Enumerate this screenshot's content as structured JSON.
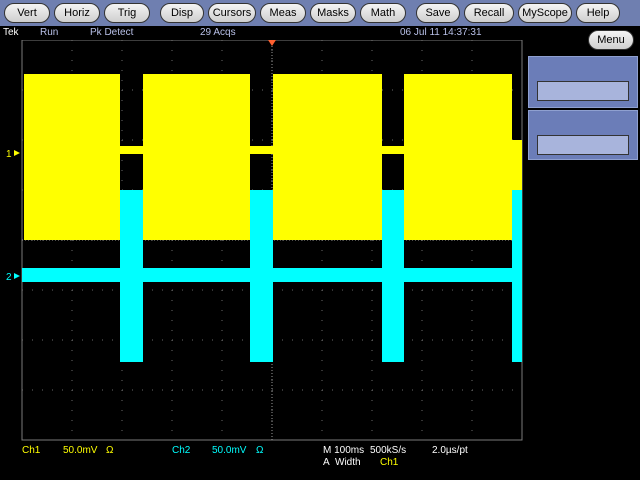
{
  "toolbar": {
    "buttons": [
      "Vert",
      "Horiz",
      "Trig",
      "Disp",
      "Cursors",
      "Meas",
      "Masks",
      "Math",
      "Save",
      "Recall",
      "MyScope",
      "Help"
    ]
  },
  "status": {
    "brand": "Tek",
    "mode": "Run",
    "acq_mode": "Pk Detect",
    "acqs": "29 Acqs",
    "datetime": "06 Jul 11 14:37:31"
  },
  "right_panel": {
    "menu_label": "Menu"
  },
  "markers": {
    "ch1": "1",
    "ch2": "2"
  },
  "readout": {
    "ch1_label": "Ch1",
    "ch1_scale": "50.0mV",
    "ch1_coupling": "Ω",
    "ch2_label": "Ch2",
    "ch2_scale": "50.0mV",
    "ch2_coupling": "Ω",
    "timebase": "M 100ms",
    "sample_rate": "500kS/s",
    "resolution": "2.0µs/pt",
    "trigger_prefix": "A",
    "trigger_type": "Width",
    "trigger_source": "Ch1"
  },
  "colors": {
    "ch1": "#ffff00",
    "ch2": "#00ffff",
    "toolbar": "#6f7fb0",
    "trigger_marker": "#ff6030"
  }
}
